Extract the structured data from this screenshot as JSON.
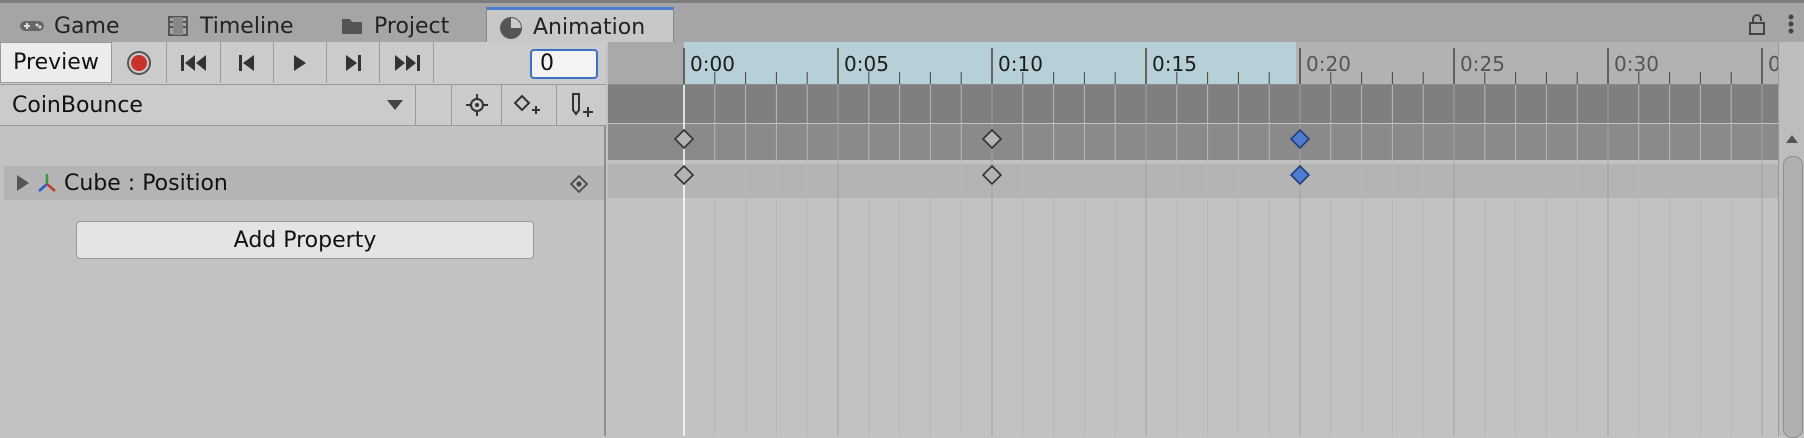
{
  "tabs": [
    {
      "label": "Game",
      "icon": "gamepad-icon"
    },
    {
      "label": "Timeline",
      "icon": "film-icon"
    },
    {
      "label": "Project",
      "icon": "folder-icon"
    },
    {
      "label": "Animation",
      "icon": "animation-clock-icon",
      "active": true
    }
  ],
  "toolbar": {
    "preview_label": "Preview",
    "frame_value": "0"
  },
  "clip": {
    "selected": "CoinBounce"
  },
  "property": {
    "label": "Cube : Position"
  },
  "add_property_label": "Add Property",
  "ruler": {
    "labels": [
      "0:00",
      "0:05",
      "0:10",
      "0:15",
      "0:20",
      "0:25",
      "0:30",
      "0:"
    ]
  },
  "keyframes": {
    "times": [
      "0:00",
      "0:10",
      "0:20"
    ],
    "selected_index": 2
  },
  "colors": {
    "accent": "#3d6fc4",
    "record": "#c8312c",
    "keyframe_selected": "#4f7bd0"
  }
}
